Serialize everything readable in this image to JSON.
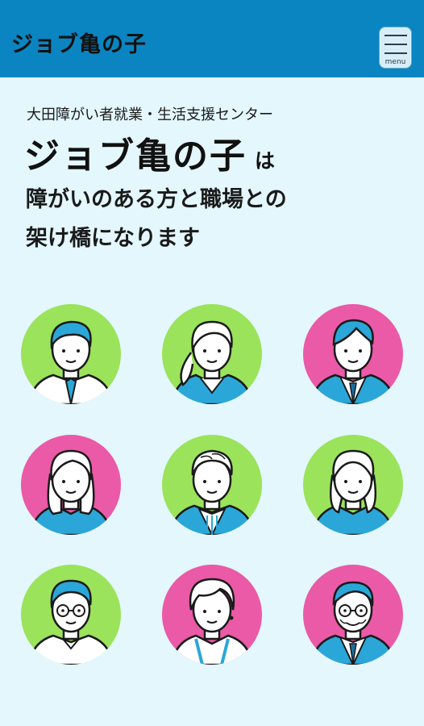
{
  "header": {
    "logo": "ジョブ亀の子",
    "menu_label": "menu"
  },
  "hero": {
    "subtitle": "大田障がい者就業・生活支援センター",
    "brand": "ジョブ亀の子",
    "particle": "は",
    "tagline_line1": "障がいのある方と職場との",
    "tagline_line2": "架け橋になります"
  },
  "colors": {
    "header_bg": "#0a85c2",
    "page_bg": "#e3f7fd",
    "avatar_green": "#9be35a",
    "avatar_pink": "#ea5aa7",
    "accent_blue": "#2aa7d8"
  },
  "avatars": [
    {
      "icon": "man-blue-hair-icon",
      "bg": "green"
    },
    {
      "icon": "woman-ponytail-icon",
      "bg": "green"
    },
    {
      "icon": "man-suit-icon",
      "bg": "pink"
    },
    {
      "icon": "woman-long-hair-icon",
      "bg": "pink"
    },
    {
      "icon": "man-striped-shirt-icon",
      "bg": "green"
    },
    {
      "icon": "woman-bob-icon",
      "bg": "green"
    },
    {
      "icon": "man-glasses-icon",
      "bg": "green"
    },
    {
      "icon": "older-woman-icon",
      "bg": "pink"
    },
    {
      "icon": "older-man-glasses-icon",
      "bg": "pink"
    }
  ]
}
